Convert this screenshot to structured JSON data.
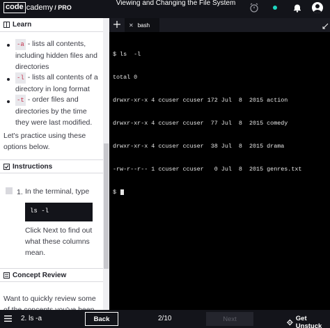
{
  "header": {
    "logo_code": "code",
    "logo_rest": "cademy",
    "logo_pro": "/ PRO",
    "title": "Viewing and Changing the File System"
  },
  "learn": {
    "header": "Learn",
    "items": [
      {
        "flag": "-a",
        "text": " - lists all contents, including hidden files and directories"
      },
      {
        "flag": "-l",
        "text": " - lists all contents of a directory in long format"
      },
      {
        "flag": "-t",
        "text": " - order files and directories by the time they were last modified."
      }
    ],
    "practice": "Let's practice using these options below."
  },
  "instructions": {
    "header": "Instructions",
    "step_number": "1.",
    "step_text": "In the terminal, type",
    "code": "ls -l",
    "followup": "Click Next to find out what these columns mean."
  },
  "concept_review": {
    "header": "Concept Review",
    "text": "Want to quickly review some of the concepts you've been learning?"
  },
  "terminal": {
    "tab_label": "bash",
    "lines": [
      "$ ls  -l",
      "total 0",
      "drwxr-xr-x 4 ccuser ccuser 172 Jul  8  2015 action",
      "drwxr-xr-x 4 ccuser ccuser  77 Jul  8  2015 comedy",
      "drwxr-xr-x 4 ccuser ccuser  38 Jul  8  2015 drama",
      "-rw-r--r-- 1 ccuser ccuser   0 Jul  8  2015 genres.txt"
    ],
    "prompt": "$ "
  },
  "footer": {
    "lesson": "2. ls -a",
    "back": "Back",
    "progress": "2/10",
    "next": "Next",
    "get_unstuck": "Get Unstuck"
  },
  "colors": {
    "accent": "#1dd6c0",
    "terminal_bg": "#000000",
    "code_flag": "#c4314b"
  },
  "icons": [
    "clock-icon",
    "status-dot-icon",
    "bell-icon",
    "avatar",
    "book-icon",
    "checkbox-icon",
    "lightbulb-icon",
    "plus-icon",
    "close-icon",
    "expand-icon",
    "menu-icon",
    "gear-icon"
  ]
}
